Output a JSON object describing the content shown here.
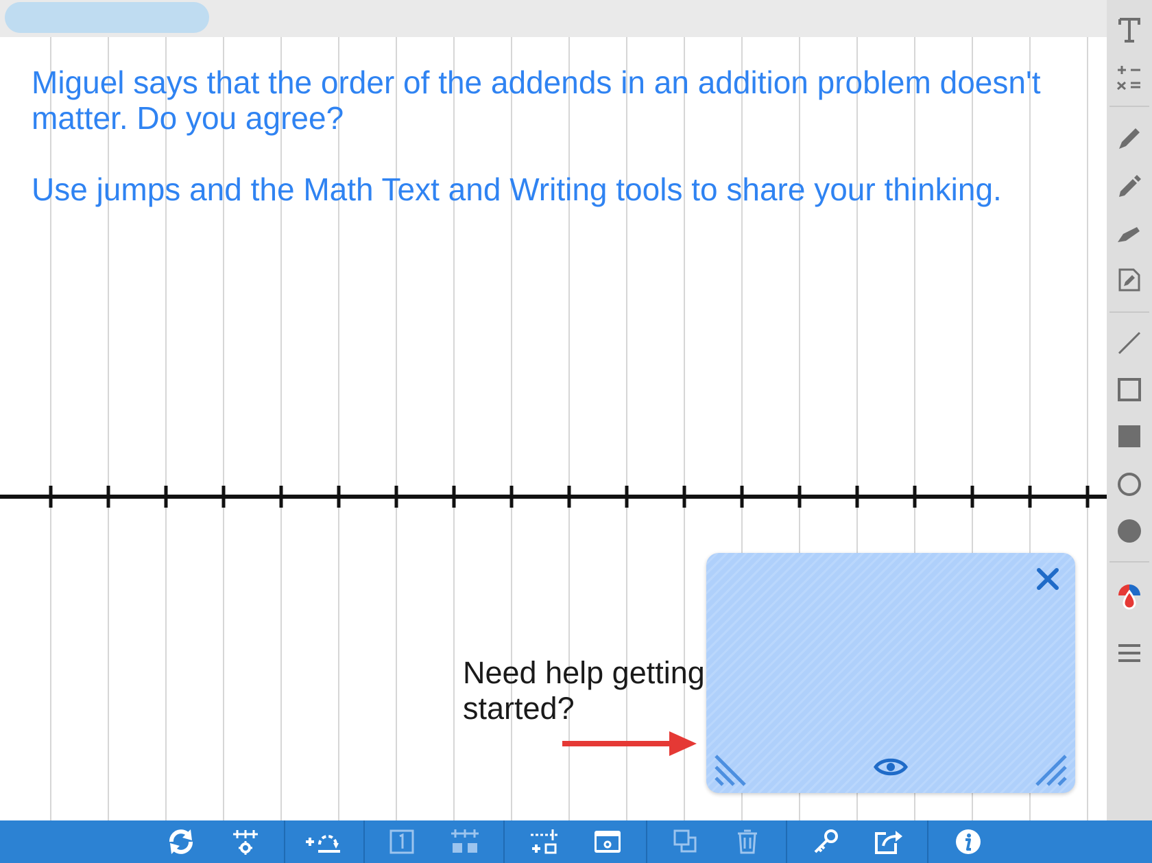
{
  "prompt": {
    "line1": "Miguel says that the order of the addends in an addition problem doesn't matter. Do you agree?",
    "line2": "Use jumps and the Math Text and Writing tools to share your thinking."
  },
  "hint": {
    "text": "Need help getting started?",
    "card_color": "#afd0fb",
    "close_icon": "close-icon",
    "eye_icon": "eye-icon"
  },
  "colors": {
    "prompt_text": "#2f83f2",
    "toolbar_bg": "#2c82d3",
    "sidebar_bg": "#dedede",
    "arrow": "#e53935"
  },
  "number_line": {
    "tick_count": 19
  },
  "sidebar_tools": [
    "text-tool-icon",
    "math-text-tool-icon",
    "pen-icon",
    "marker-icon",
    "highlighter-icon",
    "sticky-note-icon",
    "line-tool-icon",
    "rectangle-outline-icon",
    "rectangle-filled-icon",
    "circle-outline-icon",
    "circle-filled-icon",
    "color-picker-icon",
    "stroke-width-icon"
  ],
  "bottom_tools": [
    "rotate-icon",
    "number-line-settings-icon",
    "add-jump-icon",
    "number-label-icon",
    "tick-marks-icon",
    "add-tick-icon",
    "hide-show-icon",
    "duplicate-icon",
    "trash-icon",
    "key-icon",
    "share-icon",
    "info-icon"
  ]
}
